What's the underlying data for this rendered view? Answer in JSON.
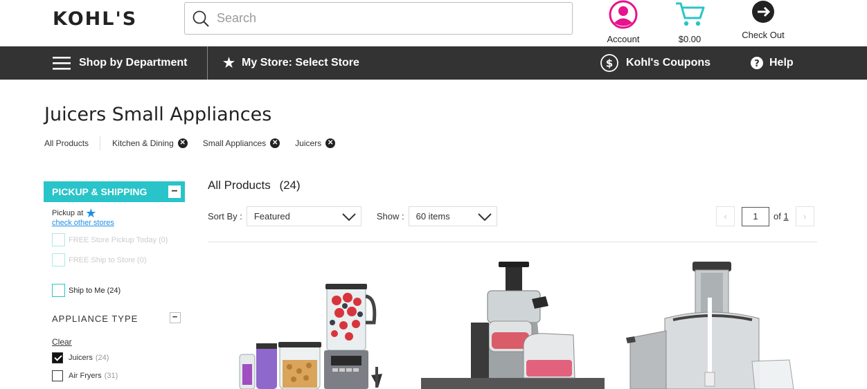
{
  "header": {
    "logo_text": "KOHL'S",
    "search_placeholder": "Search",
    "account_label": "Account",
    "cart_total": "$0.00",
    "checkout_label": "Check Out",
    "accent_pink": "#e8128c",
    "accent_teal": "#28c4c9"
  },
  "nav": {
    "shop_by_department": "Shop by Department",
    "my_store": "My Store: Select Store",
    "coupons": "Kohl's Coupons",
    "help": "Help"
  },
  "page": {
    "title": "Juicers Small Appliances",
    "breadcrumbs": {
      "all": "All Products",
      "items": [
        "Kitchen & Dining",
        "Small Appliances",
        "Juicers"
      ]
    }
  },
  "filters": {
    "pickup_header": "PICKUP & SHIPPING",
    "pickup_at": "Pickup at",
    "check_other_stores": "check other stores",
    "options": [
      {
        "label": "FREE Store Pickup Today (0)",
        "enabled": false
      },
      {
        "label": "FREE Ship to Store (0)",
        "enabled": false
      },
      {
        "label": "Ship to Me (24)",
        "enabled": true
      }
    ],
    "appliance_type_header": "APPLIANCE TYPE",
    "clear": "Clear",
    "appliance_types": [
      {
        "label": "Juicers",
        "count": "(24)",
        "checked": true
      },
      {
        "label": "Air Fryers",
        "count": "(31)",
        "checked": false
      }
    ]
  },
  "results": {
    "heading": "All Products",
    "count": "(24)",
    "sort_label": "Sort By :",
    "sort_value": "Featured",
    "show_label": "Show :",
    "show_value": "60 items",
    "page_current": "1",
    "page_of": "of",
    "page_total": "1"
  }
}
